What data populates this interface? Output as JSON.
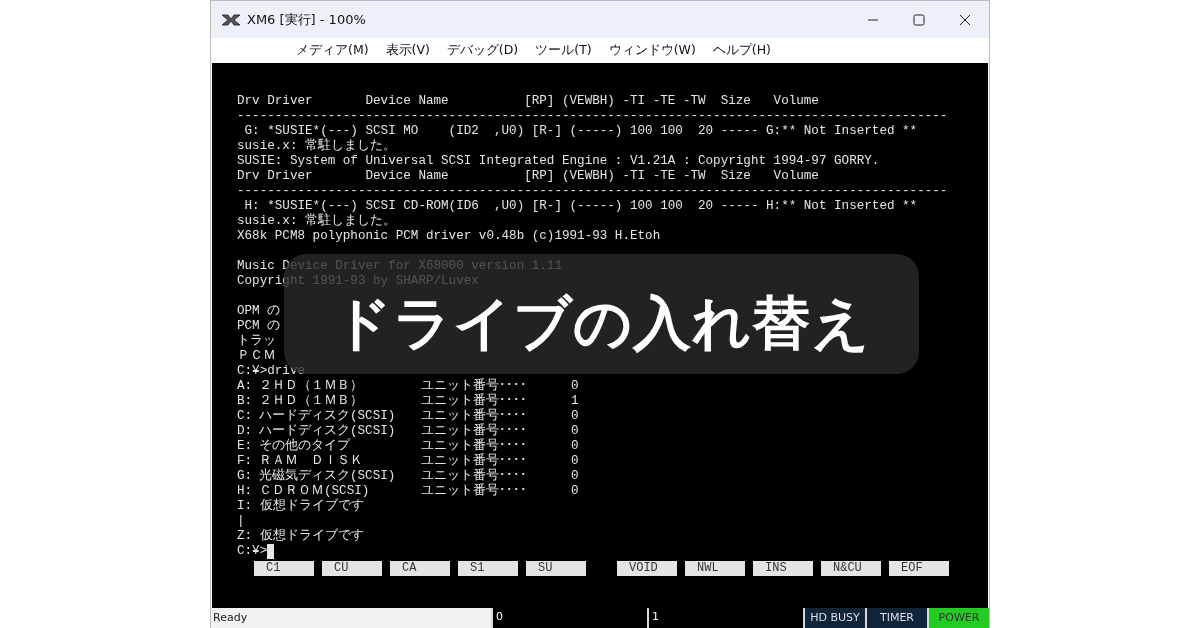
{
  "window": {
    "title": "XM6 [実行] - 100%"
  },
  "menu": [
    "メディア(M)",
    "表示(V)",
    "デバッグ(D)",
    "ツール(T)",
    "ウィンドウ(W)",
    "ヘルプ(H)"
  ],
  "terminal": [
    {
      "kind": "line",
      "text": "Drv Driver       Device Name          [RP] (VEWBH) -TI -TE -TW  Size   Volume"
    },
    {
      "kind": "line",
      "text": "----------------------------------------------------------------------------------------------"
    },
    {
      "kind": "line",
      "text": " G: *SUSIE*(---) SCSI MO    (ID2  ,U0) [R-] (-----) 100 100  20 ----- G:** Not Inserted **"
    },
    {
      "kind": "line",
      "text": "susie.x: 常駐しました。"
    },
    {
      "kind": "line",
      "text": "SUSIE: System of Universal SCSI Integrated Engine : V1.21A : Copyright 1994-97 GORRY."
    },
    {
      "kind": "line",
      "text": "Drv Driver       Device Name          [RP] (VEWBH) -TI -TE -TW  Size   Volume"
    },
    {
      "kind": "line",
      "text": "----------------------------------------------------------------------------------------------"
    },
    {
      "kind": "line",
      "text": " H: *SUSIE*(---) SCSI CD-ROM(ID6  ,U0) [R-] (-----) 100 100  20 ----- H:** Not Inserted **"
    },
    {
      "kind": "line",
      "text": "susie.x: 常駐しました。"
    },
    {
      "kind": "line",
      "text": "X68k PCM8 polyphonic PCM driver v0.48b (c)1991-93 H.Etoh"
    },
    {
      "kind": "blank"
    },
    {
      "kind": "line",
      "text": "Music Device Driver for X68000 version 1.11"
    },
    {
      "kind": "line",
      "text": "Copyright 1991-93 by SHARP/Luvex"
    },
    {
      "kind": "blank"
    },
    {
      "kind": "line",
      "text": "OPM の"
    },
    {
      "kind": "line",
      "text": "PCM の"
    },
    {
      "kind": "line",
      "text": "トラッ"
    },
    {
      "kind": "line",
      "text": "ＰＣＭ"
    },
    {
      "kind": "line",
      "text": "C:¥>drive"
    },
    {
      "kind": "drive",
      "drive": "A:",
      "type": "２ＨＤ（１ＭＢ）",
      "unit_label": "ユニット番号････",
      "unit": "0"
    },
    {
      "kind": "drive",
      "drive": "B:",
      "type": "２ＨＤ（１ＭＢ）",
      "unit_label": "ユニット番号････",
      "unit": "1"
    },
    {
      "kind": "drive",
      "drive": "C:",
      "type": "ハードディスク(SCSI)",
      "unit_label": "ユニット番号････",
      "unit": "0"
    },
    {
      "kind": "drive",
      "drive": "D:",
      "type": "ハードディスク(SCSI)",
      "unit_label": "ユニット番号････",
      "unit": "0"
    },
    {
      "kind": "drive",
      "drive": "E:",
      "type": "その他のタイプ",
      "unit_label": "ユニット番号････",
      "unit": "0"
    },
    {
      "kind": "drive",
      "drive": "F:",
      "type": "ＲＡＭ　ＤＩＳＫ",
      "unit_label": "ユニット番号････",
      "unit": "0"
    },
    {
      "kind": "drive",
      "drive": "G:",
      "type": "光磁気ディスク(SCSI)",
      "unit_label": "ユニット番号････",
      "unit": "0"
    },
    {
      "kind": "drive",
      "drive": "H:",
      "type": "ＣＤＲＯＭ(SCSI)",
      "unit_label": "ユニット番号････",
      "unit": "0"
    },
    {
      "kind": "line",
      "text": "I: 仮想ドライブです"
    },
    {
      "kind": "line",
      "text": "|"
    },
    {
      "kind": "line",
      "text": "Z: 仮想ドライブです"
    },
    {
      "kind": "prompt",
      "text": "C:¥>"
    }
  ],
  "function_keys": {
    "left": [
      "C1",
      "CU",
      "CA",
      "S1",
      "SU"
    ],
    "right": [
      "VOID",
      "NWL",
      "INS",
      "N&CU",
      "EOF"
    ]
  },
  "status_bar": {
    "message": "Ready",
    "fields": [
      "0",
      "1"
    ],
    "indicators": [
      {
        "label": "HD BUSY",
        "on": false
      },
      {
        "label": "TIMER",
        "on": false
      },
      {
        "label": "POWER",
        "on": true
      }
    ]
  },
  "overlay": {
    "title": "ドライブの入れ替え"
  }
}
